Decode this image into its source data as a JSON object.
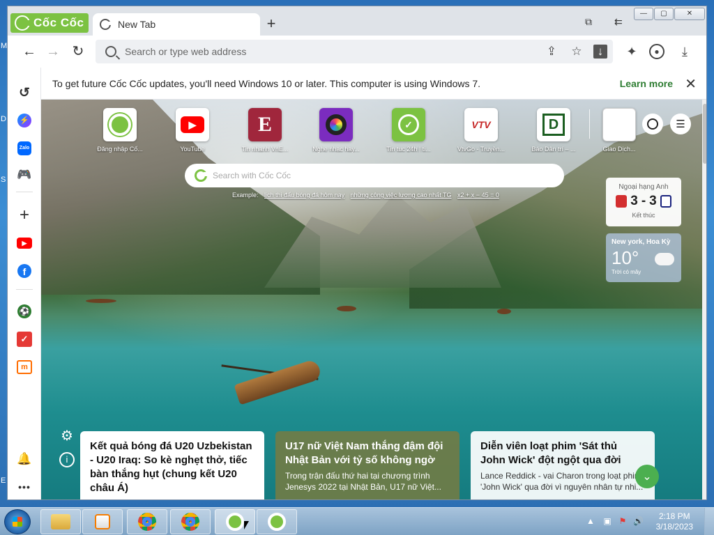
{
  "desktop": {
    "edge_letters": [
      "M",
      "D",
      "S",
      "E"
    ]
  },
  "browser": {
    "brand": "Cốc Cốc",
    "tab_title": "New Tab",
    "new_tab_symbol": "+",
    "omnibox_placeholder": "Search or type web address",
    "window_controls": [
      "—",
      "▢",
      "✕"
    ]
  },
  "notice": {
    "text": "To get future Cốc Cốc updates, you'll need Windows 10 or later. This computer is using Windows 7.",
    "learn_more": "Learn more",
    "close": "✕"
  },
  "sidebar": {
    "items": [
      {
        "name": "history-icon",
        "glyph": "↺",
        "color": "#333"
      },
      {
        "name": "messenger-icon",
        "glyph": "⚡",
        "color": "#1877f2"
      },
      {
        "name": "zalo-icon",
        "glyph": "Zalo",
        "color": "#0068ff"
      },
      {
        "name": "game-icon",
        "glyph": "🎮",
        "color": "#2e7d32"
      },
      {
        "name": "add-icon",
        "glyph": "+",
        "color": "#333"
      },
      {
        "name": "youtube-icon",
        "glyph": "▶",
        "color": "#ff0000"
      },
      {
        "name": "facebook-icon",
        "glyph": "f",
        "color": "#1877f2"
      },
      {
        "name": "football-icon",
        "glyph": "⚽",
        "color": "#2e7d32"
      },
      {
        "name": "checklist-icon",
        "glyph": "✓",
        "color": "#e53935"
      },
      {
        "name": "shop-icon",
        "glyph": "m",
        "color": "#ff6d00"
      },
      {
        "name": "notification-icon",
        "glyph": "🔔",
        "color": "#333"
      },
      {
        "name": "more-icon",
        "glyph": "•••",
        "color": "#333"
      }
    ]
  },
  "speed_dial": [
    {
      "label": "Đăng nhập Cố...",
      "glyph": "C",
      "color": "#7cc242",
      "bg": "#ffffff"
    },
    {
      "label": "YouTube",
      "glyph": "▶",
      "color": "#ffffff",
      "bg": "#ff0000"
    },
    {
      "label": "Tin nhanh VnE...",
      "glyph": "E",
      "color": "#ffffff",
      "bg": "#a0263c"
    },
    {
      "label": "Nghe nhạc hay...",
      "glyph": "◉",
      "color": "#ffffff",
      "bg": "#7b2cbf"
    },
    {
      "label": "Tin tuc 24h | ti...",
      "glyph": "◷",
      "color": "#ffffff",
      "bg": "#7cc242"
    },
    {
      "label": "VtvGo - Truyền...",
      "glyph": "VTV",
      "color": "#c62828",
      "bg": "#ffffff"
    },
    {
      "label": "Báo Dân trí – ...",
      "glyph": "D",
      "color": "#1b5e20",
      "bg": "#ffffff"
    },
    {
      "label": "Giao Dịch...",
      "glyph": "",
      "color": "#666666",
      "bg": "#ffffff"
    }
  ],
  "search": {
    "placeholder": "Search with Cốc Cốc",
    "examples_label": "Example:",
    "examples": [
      "lịch thi đấu bóng đá hôm nay",
      "những công việc lương cao nhất TG",
      "x2 + x − 45 = 0"
    ]
  },
  "widgets": {
    "score": {
      "league": "Ngoại hạng Anh",
      "home_score": "3",
      "separator": "-",
      "away_score": "3",
      "status": "Kết thúc",
      "home_color": "#d32f2f",
      "away_color": "#1a237e"
    },
    "weather": {
      "location": "New york, Hoa Kỳ",
      "temperature": "10°",
      "description": "Trời có mây"
    }
  },
  "news": [
    {
      "title": "Kết quả bóng đá U20 Uzbekistan - U20 Iraq: So kè nghẹt thở, tiếc bàn thắng hụt (chung kết U20 châu Á)",
      "desc": ""
    },
    {
      "title": "U17 nữ Việt Nam thắng đậm đội Nhật Bản với tỷ số không ngờ",
      "desc": "Trong trận đấu thứ hai tại chương trình Jenesys 2022 tại Nhật Bản, U17 nữ Việt..."
    },
    {
      "title": "Diễn viên loạt phim 'Sát thủ John Wick' đột ngột qua đời",
      "desc": "Lance Reddick - vai Charon trong loạt phim 'John Wick' qua đời vì nguyên nhân tự nhi..."
    }
  ],
  "taskbar": {
    "time": "2:18 PM",
    "date": "3/18/2023"
  }
}
